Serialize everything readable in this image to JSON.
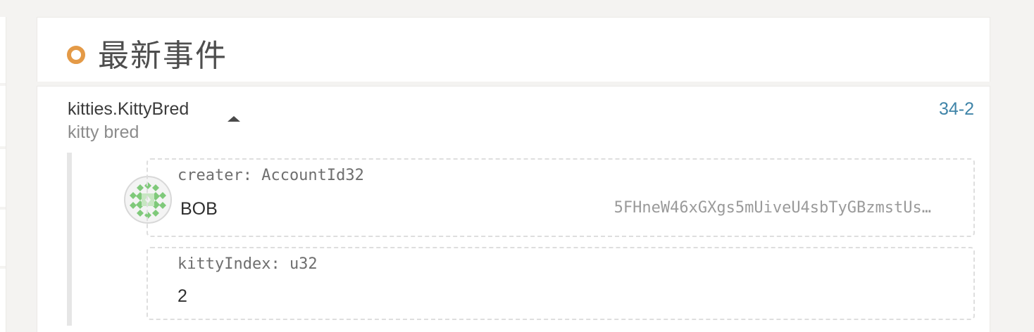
{
  "header": {
    "title": "最新事件",
    "accent_color": "#e49a47"
  },
  "event": {
    "name": "kitties.KittyBred",
    "description": "kitty bred",
    "id": "34-2",
    "id_color": "#3f84a8",
    "params": [
      {
        "label": "creater: AccountId32",
        "account_name": "BOB",
        "account_address": "5FHneW46xGXgs5mUiveU4sbTyGBzmstUs…",
        "identicon": "account-identicon"
      },
      {
        "label": "kittyIndex: u32",
        "value": "2"
      }
    ]
  }
}
